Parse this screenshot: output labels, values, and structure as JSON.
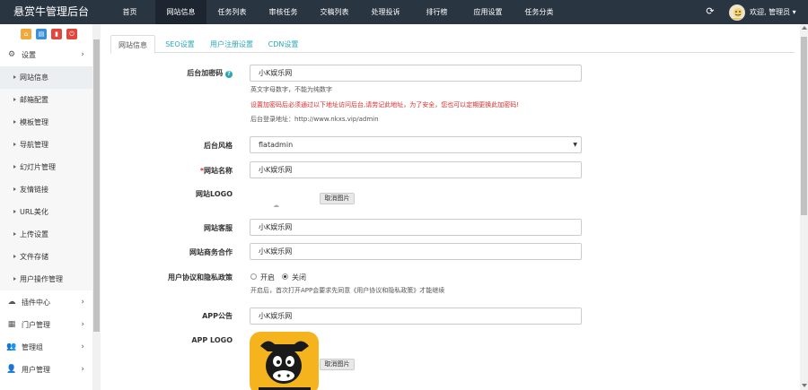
{
  "app": {
    "title": "悬赏牛管理后台"
  },
  "topnav": [
    "首页",
    "网站信息",
    "任务列表",
    "审核任务",
    "交稿列表",
    "处理投诉",
    "排行榜",
    "应用设置",
    "任务分类"
  ],
  "topnav_active": 1,
  "user": {
    "greeting": "欢迎, 管理员 ▾"
  },
  "colors": {
    "topbar": "#2a3542",
    "accent": "#2aa8b5",
    "danger": "#e02a2a",
    "quick": [
      "#f0a93b",
      "#3a8fd9",
      "#e0483e",
      "#e0483e"
    ]
  },
  "sidebar": {
    "settings": "设置",
    "subitems": [
      "网站信息",
      "邮箱配置",
      "模板管理",
      "导航管理",
      "幻灯片管理",
      "友情链接",
      "URL美化",
      "上传设置",
      "文件存储",
      "用户操作管理"
    ],
    "groups": [
      "插件中心",
      "门户管理",
      "管理组",
      "用户管理"
    ],
    "group_icons": [
      "cloud-icon",
      "grid-icon",
      "users-icon",
      "user-icon"
    ]
  },
  "tabs": [
    "网站信息",
    "SEO设置",
    "用户注册设置",
    "CDN设置"
  ],
  "form": {
    "admin_code_label": "后台加密码",
    "admin_code_value": "小K娱乐网",
    "admin_code_help1": "英文字母数字，不能为纯数字",
    "admin_code_help2": "设置加密码后必须通过以下地址访问后台,请劳记此地址，为了安全，您也可以定期更换此加密码!",
    "admin_code_help3": "后台登录地址：http://www.nkxs.vip/admin",
    "style_label": "后台风格",
    "style_value": "flatadmin",
    "site_name_label": "网站名称",
    "site_name_value": "小K娱乐网",
    "logo_label": "网站LOGO",
    "cancel_image": "取消图片",
    "service_label": "网站客服",
    "service_value": "小K娱乐网",
    "business_label": "网站商务合作",
    "business_value": "小K娱乐网",
    "policy_label": "用户协议和隐私政策",
    "policy_on": "开启",
    "policy_off": "关闭",
    "policy_help": "开启后，首次打开APP会要求先同意《用户协议和隐私政策》才能继续",
    "app_notice_label": "APP公告",
    "app_notice_value": "小K娱乐网",
    "app_logo_label": "APP LOGO"
  }
}
